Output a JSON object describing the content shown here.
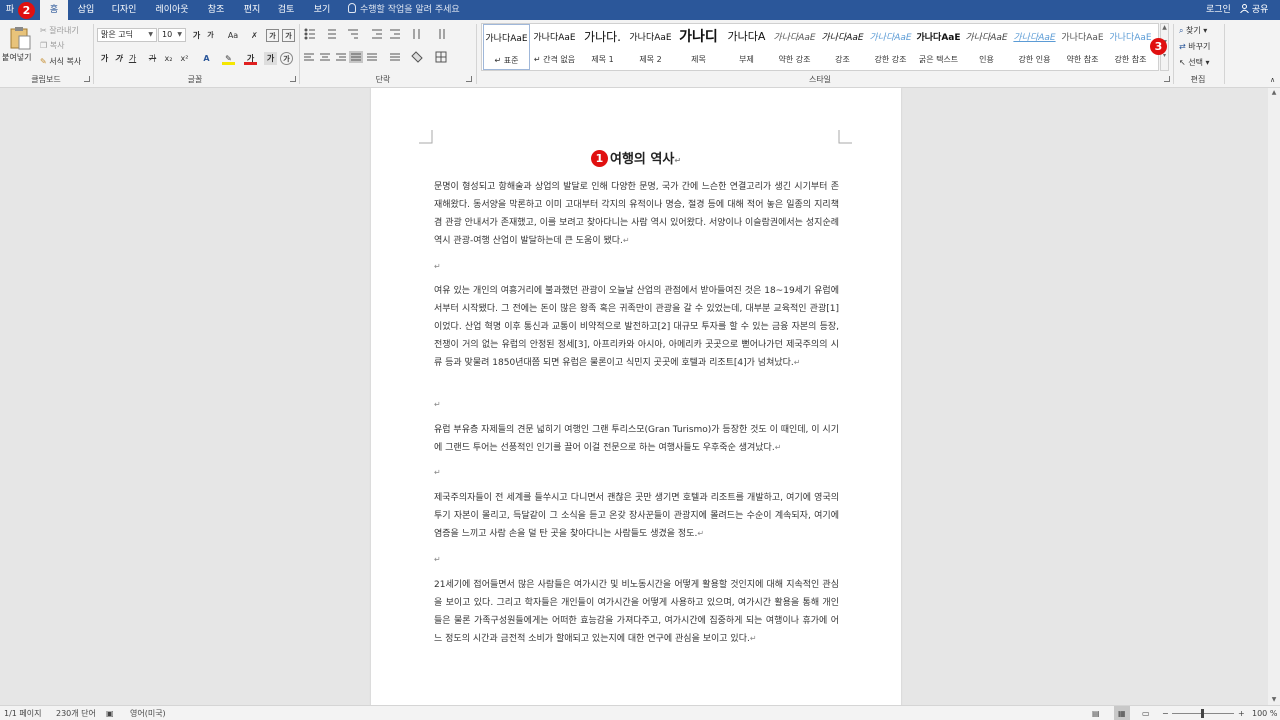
{
  "tabs": {
    "file": "파일",
    "home": "홈",
    "insert": "삽입",
    "design": "디자인",
    "layout": "레이아웃",
    "references": "참조",
    "mailings": "편지",
    "review": "검토",
    "view": "보기",
    "tell_me": "수행할 작업을 알려 주세요",
    "sign_in": "로그인",
    "share": "공유"
  },
  "clipboard": {
    "paste": "붙여넣기",
    "cut": "잘라내기",
    "copy": "복사",
    "format_painter": "서식 복사",
    "label": "클립보드"
  },
  "font": {
    "name": "맑은 고딕",
    "size": "10",
    "label": "글꼴",
    "buttons": [
      "가",
      "가",
      "가",
      "가",
      "x₂",
      "x²"
    ]
  },
  "paragraph": {
    "label": "단락"
  },
  "styles": {
    "label": "스타일",
    "items": [
      {
        "sample": "가나다AaE",
        "name": "↵ 표준"
      },
      {
        "sample": "가나다AaE",
        "name": "↵ 간격 없음"
      },
      {
        "sample": "가나다.",
        "name": "제목 1"
      },
      {
        "sample": "가나다AaE",
        "name": "제목 2"
      },
      {
        "sample": "가나디",
        "name": "제목"
      },
      {
        "sample": "가나다A",
        "name": "부제"
      },
      {
        "sample": "가나다AaE",
        "name": "약한 강조"
      },
      {
        "sample": "가나다AaE",
        "name": "강조"
      },
      {
        "sample": "가나다AaE",
        "name": "강한 강조"
      },
      {
        "sample": "가나다AaE",
        "name": "굵은 텍스트"
      },
      {
        "sample": "가나다AaE",
        "name": "인용"
      },
      {
        "sample": "가나다AaE",
        "name": "강한 인용"
      },
      {
        "sample": "가나다AaE",
        "name": "약한 참조"
      },
      {
        "sample": "가나다AaE",
        "name": "강한 참조"
      }
    ]
  },
  "editing": {
    "find": "찾기",
    "replace": "바꾸기",
    "select": "선택",
    "label": "편집"
  },
  "badges": {
    "one": "1",
    "two": "2",
    "three": "3"
  },
  "document": {
    "title": "여행의 역사",
    "paragraphs": [
      "문명이 형성되고 항해술과 상업의 발달로 인해 다양한 문명, 국가 간에 느슨한 연결고리가 생긴 시기부터 존재해왔다. 동서양을 막론하고 이미 고대부터 각지의 유적이나 명승, 절경 등에 대해 적어 놓은 일종의 지리책 겸 관광 안내서가 존재했고, 이를 보려고 찾아다니는 사람 역시 있어왔다. 서양이나 이슬람권에서는 성지순례 역시 관광-여행 산업이 발달하는데 큰 도움이 됐다.",
      "여유 있는 개인의 여흥거리에 불과했던 관광이 오늘날 산업의 관점에서 받아들여진 것은 18~19세기 유럽에서부터 시작됐다. 그 전에는 돈이 많은 왕족 혹은 귀족만이 관광을 갈 수 있었는데, 대부분 교육적인 관광[1]이었다. 산업 혁명 이후 통신과 교통이 비약적으로 발전하고[2] 대규모 투자를 할 수 있는 금융 자본의 등장, 전쟁이 거의 없는 유럽의 안정된 정세[3], 아프리카와 아시아, 아메리카 곳곳으로 뻗어나가던 제국주의의 시류 등과 맞물려 1850년대쯤 되면 유럽은 물론이고 식민지 곳곳에 호텔과 리조트[4]가 넘쳐났다.",
      "유럽 부유층 자제들의 견문 넓히기 여행인 그랜 투리스모(Gran Turismo)가 등장한 것도 이 때인데, 이 시기에 그랜드 투어는 선풍적인 인기를 끌어 이걸 전문으로 하는 여행사들도 우후죽순 생겨났다.",
      "제국주의자들이 전 세계를 들쑤시고 다니면서 괜찮은 곳만 생기면 호텔과 리조트를 개발하고, 여기에 영국의 투기 자본이 몰리고, 득달같이 그 소식을 듣고 온갖 장사꾼들이 관광지에 몰려드는 수순이 계속되자, 여기에 염증을 느끼고 사람 손을 덜 탄 곳을 찾아다니는 사람들도 생겼을 정도.",
      "21세기에 접어들면서 많은 사람들은 여가시간 및 비노동시간을 어떻게 활용할 것인지에 대해 지속적인 관심을 보이고 있다. 그리고 학자들은 개인들이 여가시간을 어떻게 사용하고 있으며, 여가시간 활용을 통해 개인들은 물론 가족구성원들에게는 어떠한 효능감을 가져다주고, 여가시간에 집중하게 되는 여행이나 휴가에 어느 정도의 시간과 금전적 소비가 할애되고 있는지에 대한 연구에 관심을 보이고 있다."
    ]
  },
  "status": {
    "page": "1/1 페이지",
    "words": "230개 단어",
    "language": "영어(미국)",
    "zoom": "100 %"
  }
}
